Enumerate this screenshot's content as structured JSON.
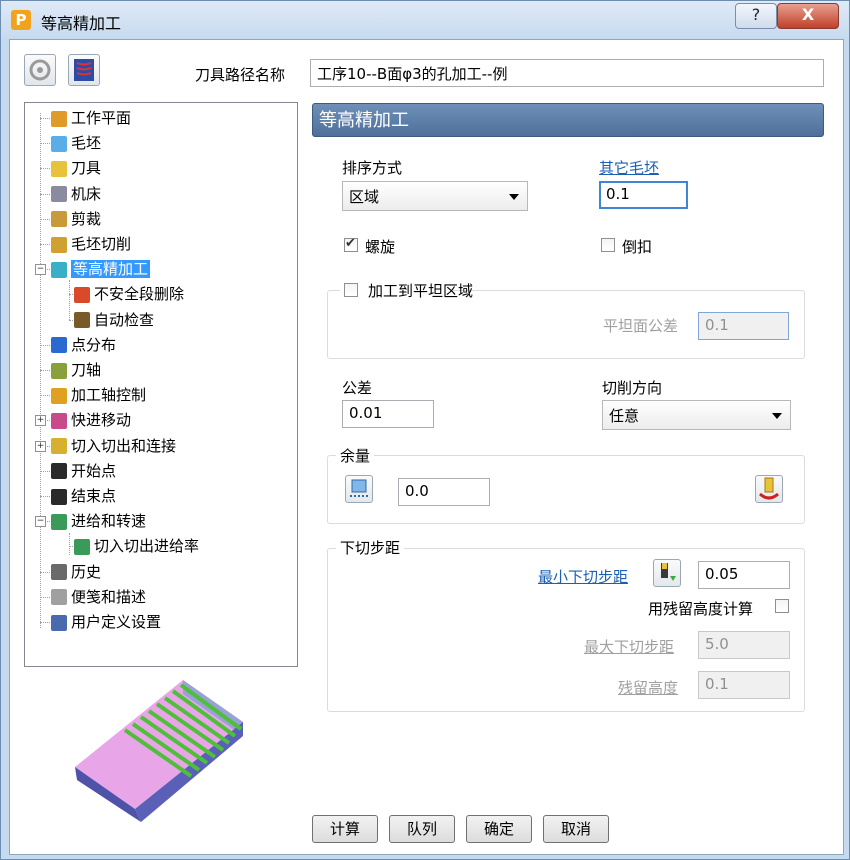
{
  "window": {
    "title": "等高精加工",
    "app_icon_letter": "P",
    "help_glyph": "?",
    "close_glyph": "X"
  },
  "toolbar": {
    "toolpath_name_label": "刀具路径名称",
    "toolpath_name_value": "工序10--B面φ3的孔加工--例"
  },
  "tree": {
    "items": [
      {
        "label": "工作平面",
        "icon": "workplane-icon"
      },
      {
        "label": "毛坯",
        "icon": "block-icon"
      },
      {
        "label": "刀具",
        "icon": "tool-icon"
      },
      {
        "label": "机床",
        "icon": "machine-icon"
      },
      {
        "label": "剪裁",
        "icon": "limit-icon"
      },
      {
        "label": "毛坯切削",
        "icon": "stock-cut-icon"
      },
      {
        "label": "等高精加工",
        "icon": "constant-z-icon",
        "selected": true
      },
      {
        "label": "不安全段删除",
        "icon": "unsafe-segment-icon"
      },
      {
        "label": "自动检查",
        "icon": "auto-verify-icon"
      },
      {
        "label": "点分布",
        "icon": "point-distribution-icon"
      },
      {
        "label": "刀轴",
        "icon": "tool-axis-icon"
      },
      {
        "label": "加工轴控制",
        "icon": "axis-control-icon"
      },
      {
        "label": "快进移动",
        "icon": "rapid-move-icon"
      },
      {
        "label": "切入切出和连接",
        "icon": "leads-links-icon"
      },
      {
        "label": "开始点",
        "icon": "start-point-icon"
      },
      {
        "label": "结束点",
        "icon": "end-point-icon"
      },
      {
        "label": "进给和转速",
        "icon": "feeds-speeds-icon"
      },
      {
        "label": "切入切出进给率",
        "icon": "lead-feed-icon"
      },
      {
        "label": "历史",
        "icon": "history-icon"
      },
      {
        "label": "便笺和描述",
        "icon": "notes-icon"
      },
      {
        "label": "用户定义设置",
        "icon": "user-settings-icon"
      }
    ]
  },
  "main": {
    "section_title": "等高精加工",
    "ordering_label": "排序方式",
    "ordering_value": "区域",
    "other_block_link": "其它毛坯",
    "other_block_value": "0.1",
    "spiral_label": "螺旋",
    "spiral_checked": true,
    "undercut_label": "倒扣",
    "undercut_checked": false,
    "machine_flats_label": "加工到平坦区域",
    "machine_flats_checked": false,
    "flat_tolerance_label": "平坦面公差",
    "flat_tolerance_value": "0.1",
    "tolerance_label": "公差",
    "tolerance_value": "0.01",
    "cut_direction_label": "切削方向",
    "cut_direction_value": "任意",
    "thickness_group_label": "余量",
    "thickness_value": "0.0",
    "stepdown_group_label": "下切步距",
    "min_stepdown_link": "最小下切步距",
    "min_stepdown_value": "0.05",
    "use_cusp_label": "用残留高度计算",
    "use_cusp_checked": false,
    "max_stepdown_label": "最大下切步距",
    "max_stepdown_value": "5.0",
    "cusp_label": "残留高度",
    "cusp_value": "0.1"
  },
  "buttons": {
    "calculate": "计算",
    "queue": "队列",
    "accept": "确定",
    "cancel": "取消"
  },
  "colors": {
    "accent": "#3399ff",
    "header": "#5a7ba6",
    "link": "#1a5fb4"
  }
}
